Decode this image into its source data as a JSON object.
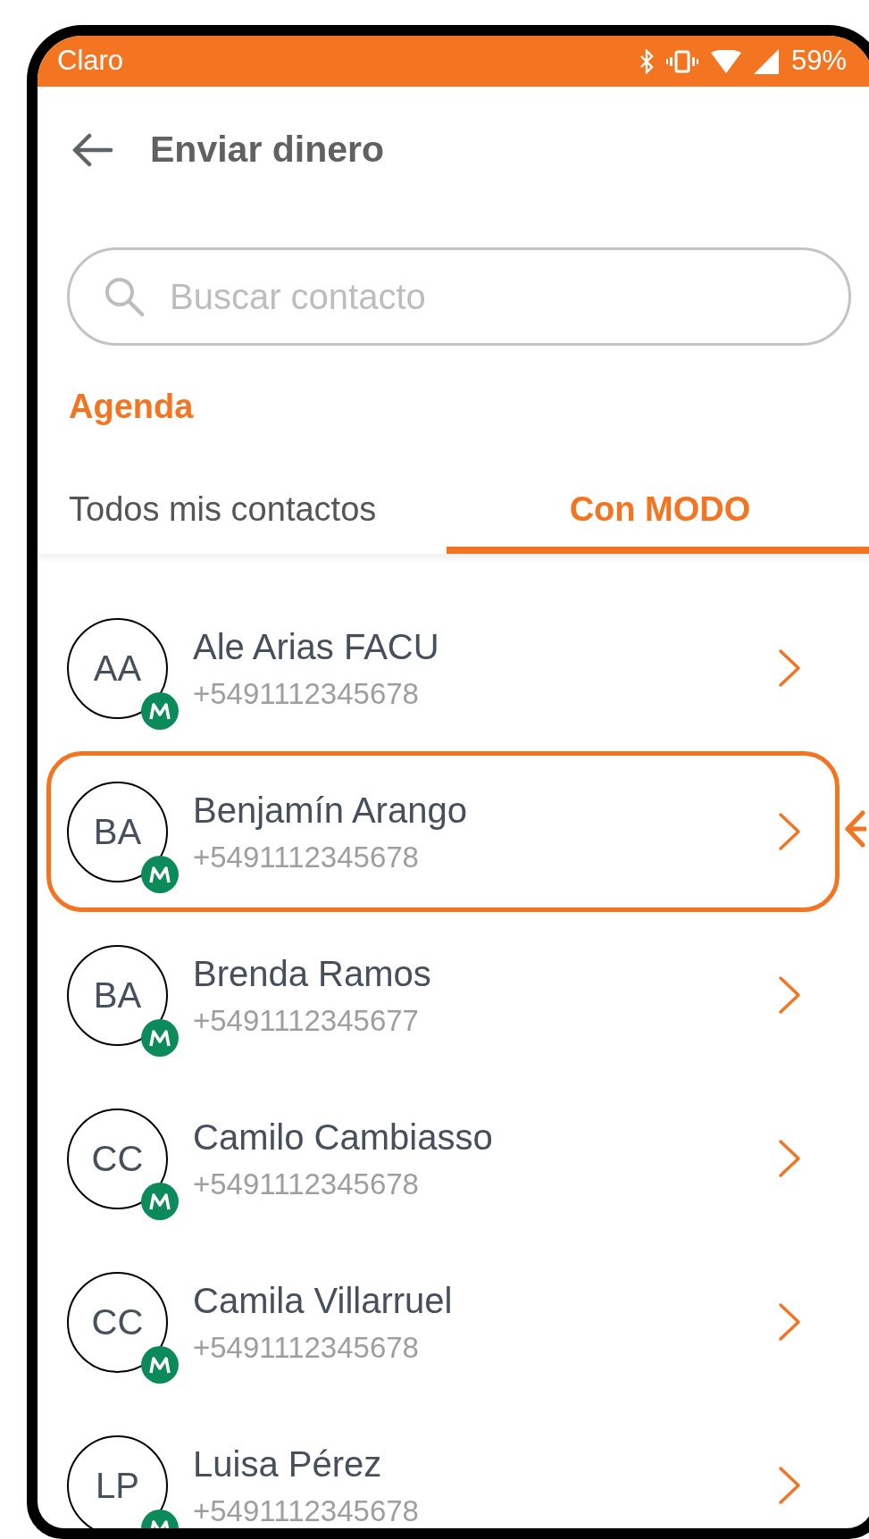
{
  "status_bar": {
    "carrier": "Claro",
    "battery": "59%"
  },
  "header": {
    "title": "Enviar dinero"
  },
  "search": {
    "placeholder": "Buscar contacto"
  },
  "section_title": "Agenda",
  "tabs": [
    {
      "label": "Todos mis contactos",
      "selected": false
    },
    {
      "label": "Con MODO",
      "selected": true
    }
  ],
  "contacts": [
    {
      "initials": "AA",
      "name": "Ale Arias FACU",
      "phone": "+5491112345678",
      "highlighted": false
    },
    {
      "initials": "BA",
      "name": "Benjamín Arango",
      "phone": "+5491112345678",
      "highlighted": true
    },
    {
      "initials": "BA",
      "name": "Brenda Ramos",
      "phone": "+5491112345677",
      "highlighted": false
    },
    {
      "initials": "CC",
      "name": "Camilo Cambiasso",
      "phone": "+5491112345678",
      "highlighted": false
    },
    {
      "initials": "CC",
      "name": "Camila Villarruel",
      "phone": "+5491112345678",
      "highlighted": false
    },
    {
      "initials": "LP",
      "name": "Luisa Pérez",
      "phone": "+5491112345678",
      "highlighted": false
    }
  ]
}
